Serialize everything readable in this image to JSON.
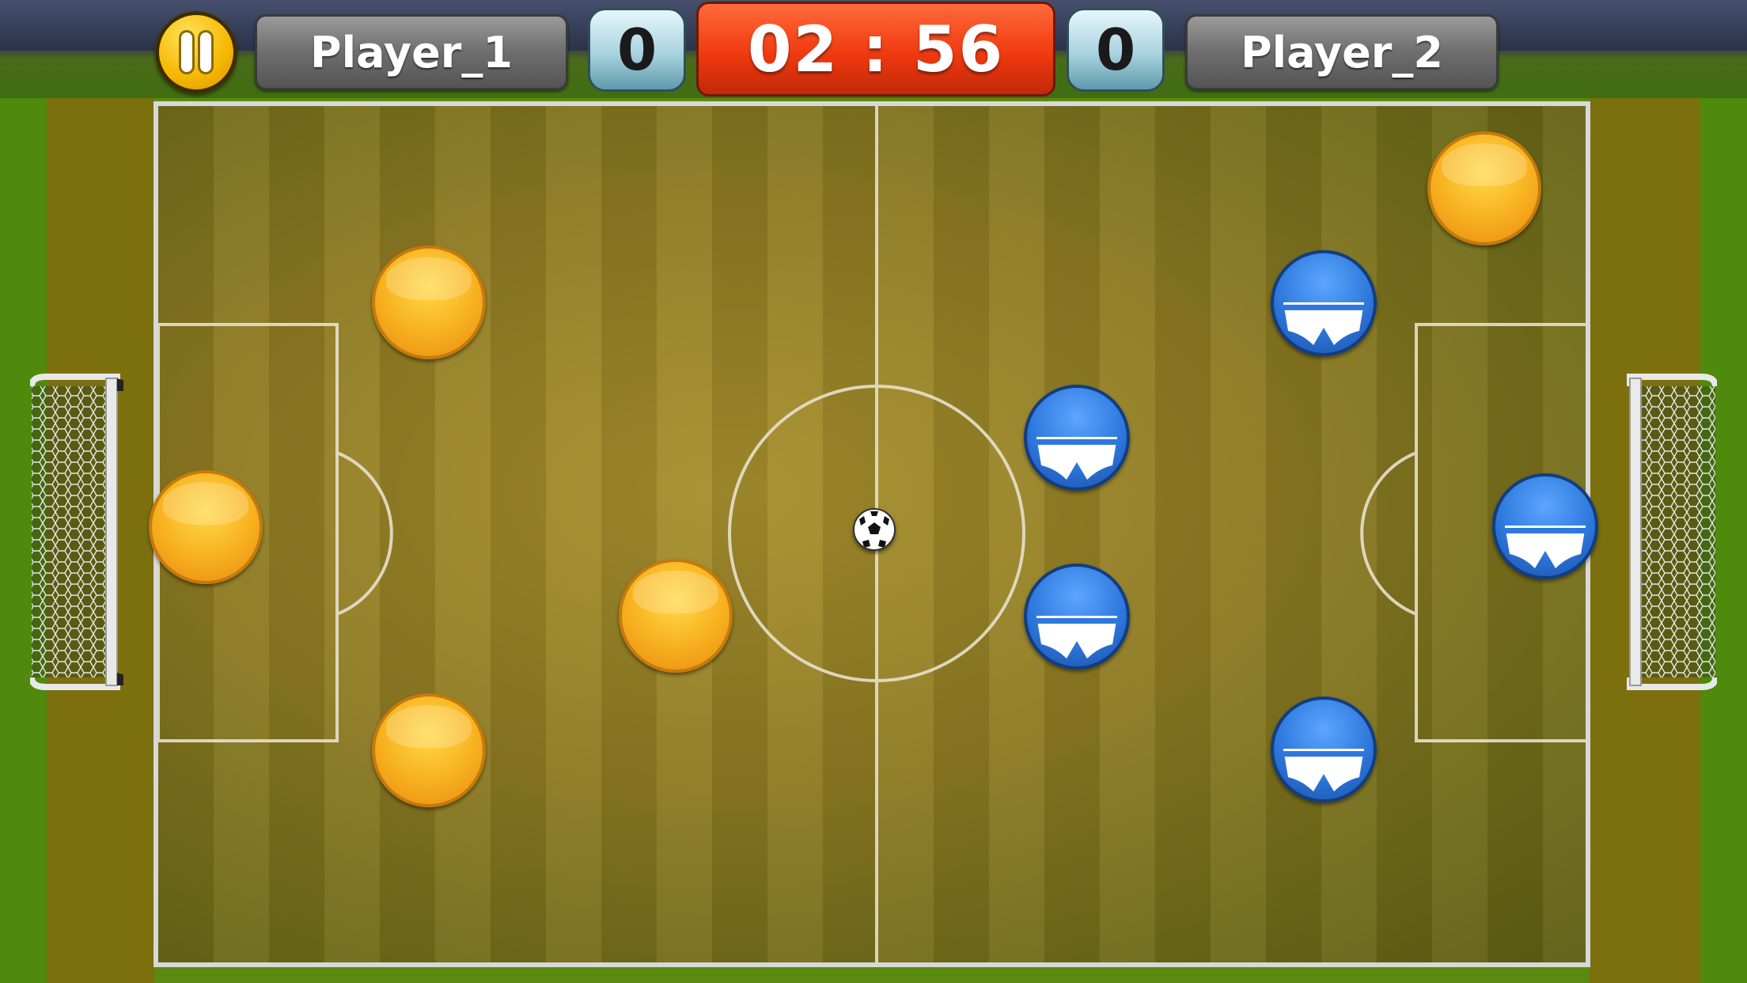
{
  "hud": {
    "player1_name": "Player_1",
    "player2_name": "Player_2",
    "player1_score": "0",
    "player2_score": "0",
    "timer": "02 : 56"
  },
  "colors": {
    "team1": "#f8b421",
    "team2": "#2e78dd",
    "timer_bg": "#f03a10",
    "grass": "#4f8a0c",
    "pitch": "#8d7a22"
  },
  "icons": {
    "pause": "pause-icon",
    "ball": "soccer-ball-icon",
    "goal_net": "goal-net-icon"
  }
}
